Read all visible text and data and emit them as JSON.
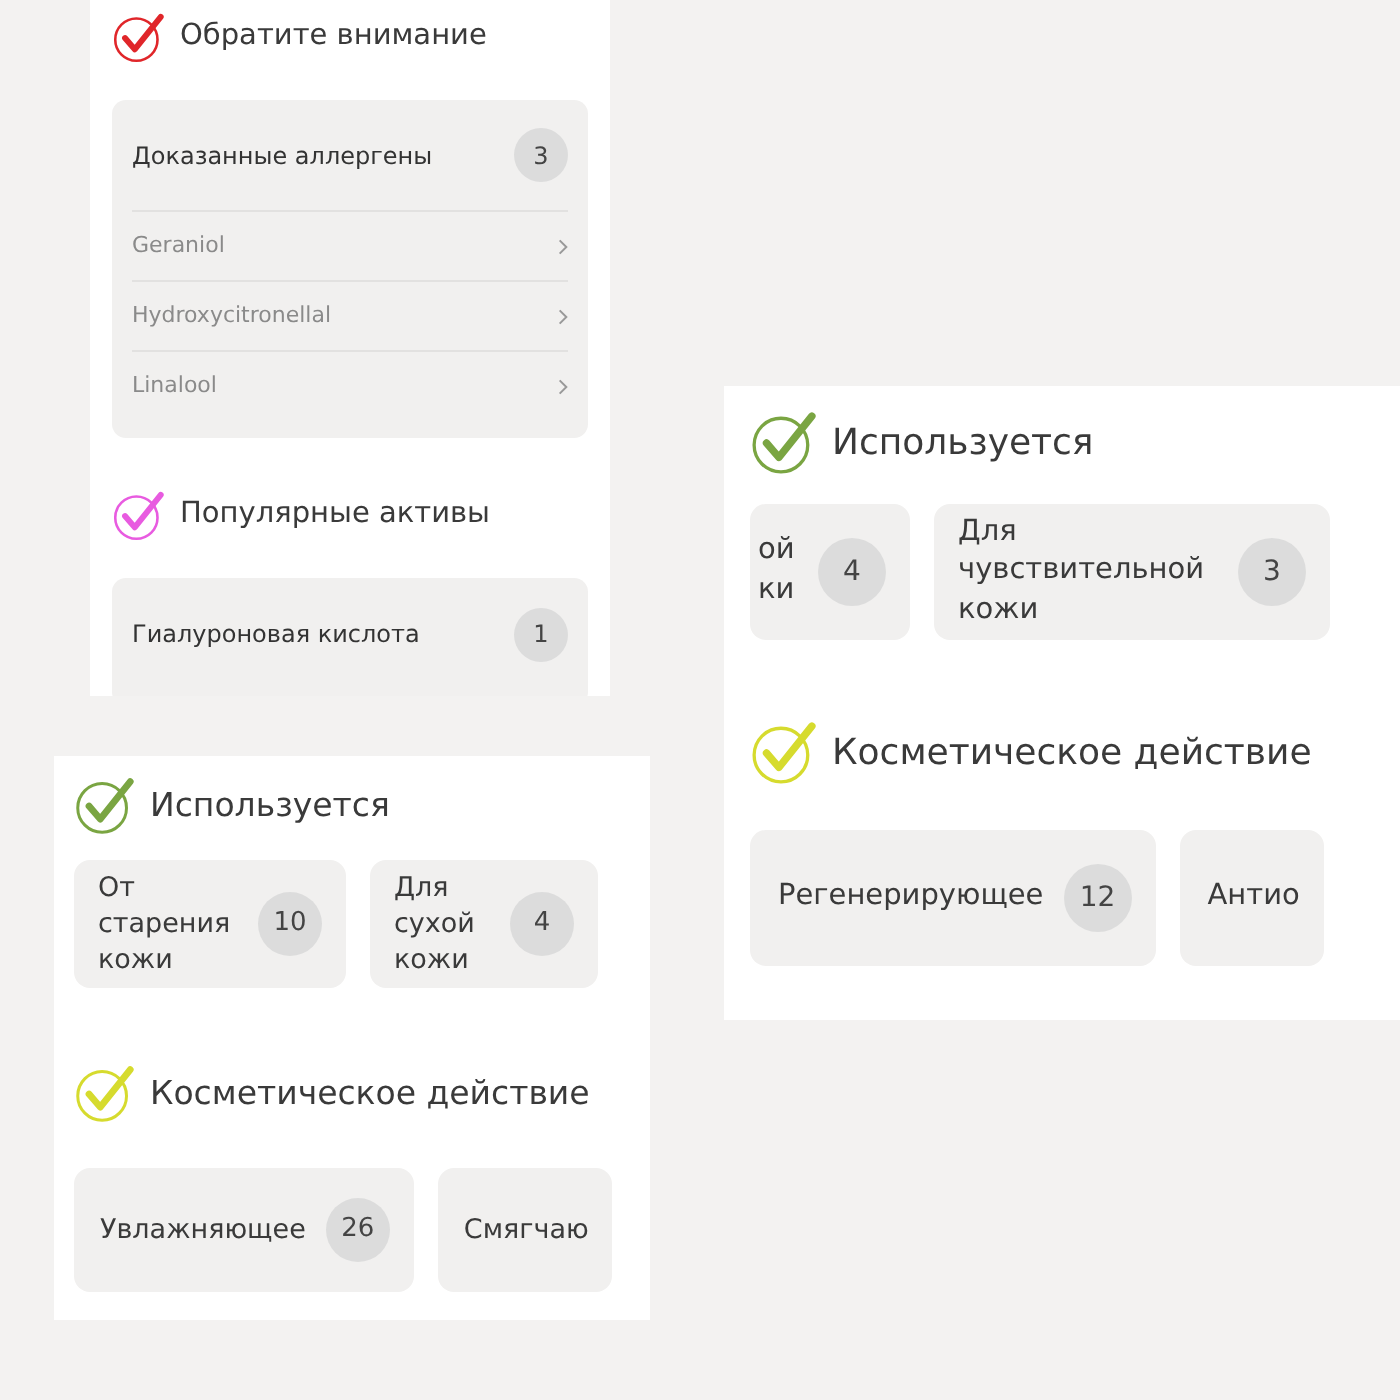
{
  "panels": [
    {
      "sections": [
        {
          "title": "Обратите внимание",
          "color": "#e0262a",
          "kind": "list",
          "card": {
            "label": "Доказанные аллергены",
            "count": "3",
            "items": [
              "Geraniol",
              "Hydroxycitronellal",
              "Linalool"
            ]
          }
        },
        {
          "title": "Популярные активы",
          "color": "#e85be0",
          "kind": "list",
          "card": {
            "label": "Гиалуроновая кислота",
            "count": "1"
          }
        }
      ]
    },
    {
      "sections": [
        {
          "title": "Используется",
          "color": "#7aa542",
          "kind": "chips",
          "chips": [
            {
              "label": "ой ки",
              "count": "4"
            },
            {
              "label": "Для чувствительной кожи",
              "count": "3"
            }
          ]
        },
        {
          "title": "Косметическое действие",
          "color": "#d6db2e",
          "kind": "chips",
          "chips": [
            {
              "label": "Регенерирующее",
              "count": "12"
            },
            {
              "label": "Антио"
            }
          ]
        }
      ]
    },
    {
      "sections": [
        {
          "title": "Используется",
          "color": "#7aa542",
          "kind": "chips",
          "chips": [
            {
              "label": "От старения кожи",
              "count": "10"
            },
            {
              "label": "Для сухой кожи",
              "count": "4"
            }
          ]
        },
        {
          "title": "Косметическое действие",
          "color": "#d6db2e",
          "kind": "chips",
          "chips": [
            {
              "label": "Увлажняющее",
              "count": "26"
            },
            {
              "label": "Смягчаю"
            }
          ]
        }
      ]
    }
  ]
}
